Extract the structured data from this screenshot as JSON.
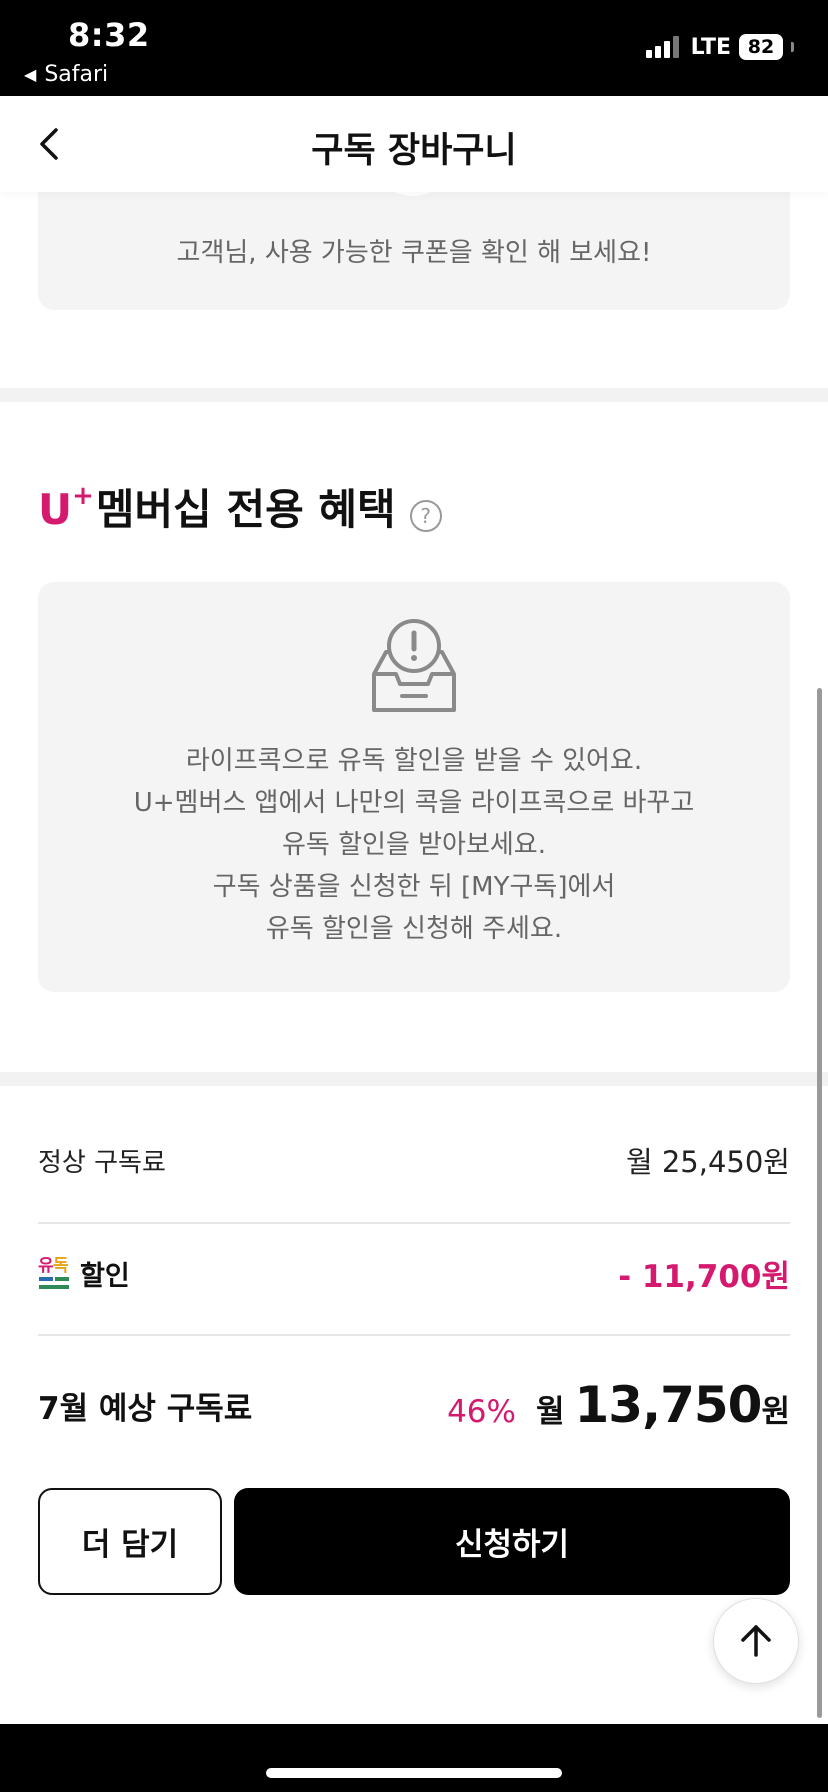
{
  "status_bar": {
    "time": "8:32",
    "back_app": "Safari",
    "network": "LTE",
    "battery": "82"
  },
  "header": {
    "title": "구독 장바구니"
  },
  "coupon": {
    "message": "고객님, 사용 가능한 쿠폰을 확인 해 보세요!"
  },
  "membership": {
    "brand": "U",
    "brand_plus": "+",
    "title": "멤버십 전용 혜택",
    "help": "?",
    "notice_lines": [
      "라이프콕으로 유독 할인을 받을 수 있어요.",
      "U+멤버스 앱에서 나만의 콕을 라이프콕으로 바꾸고",
      "유독 할인을 받아보세요.",
      "구독 상품을 신청한 뒤 [MY구독]에서",
      "유독 할인을 신청해 주세요."
    ]
  },
  "pricing": {
    "regular_label": "정상 구독료",
    "regular_value": "월 25,450원",
    "discount_logo_text": "유독",
    "discount_label": "할인",
    "discount_value": "- 11,700원",
    "total_label": "7월 예상 구독료",
    "total_rate": "46%",
    "total_prefix": "월",
    "total_amount": "13,750",
    "total_unit": "원"
  },
  "actions": {
    "add_more": "더 담기",
    "apply": "신청하기"
  },
  "colors": {
    "accent": "#d4196f",
    "logo_green": "#2e8b57",
    "logo_blue": "#2b6cb0"
  }
}
